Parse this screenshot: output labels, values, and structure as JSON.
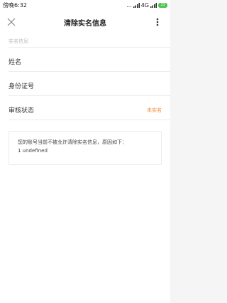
{
  "status_bar": {
    "time": "傍晚6:32",
    "network": "...",
    "net_type": "4G",
    "battery": "33"
  },
  "header": {
    "title": "清除实名信息",
    "close_icon": "close-icon",
    "more_icon": "more-vertical-icon"
  },
  "section": {
    "label": "实名信息"
  },
  "rows": [
    {
      "label": "姓名",
      "value": ""
    },
    {
      "label": "身份证号",
      "value": ""
    },
    {
      "label": "审核状态",
      "value": "未实名"
    }
  ],
  "notice": {
    "line1": "您的账号当前不被允许清除实名信息，原因如下：",
    "line2": "1 undefined"
  },
  "colors": {
    "accent_status": "#f08c3a",
    "battery": "#4cc64c"
  }
}
